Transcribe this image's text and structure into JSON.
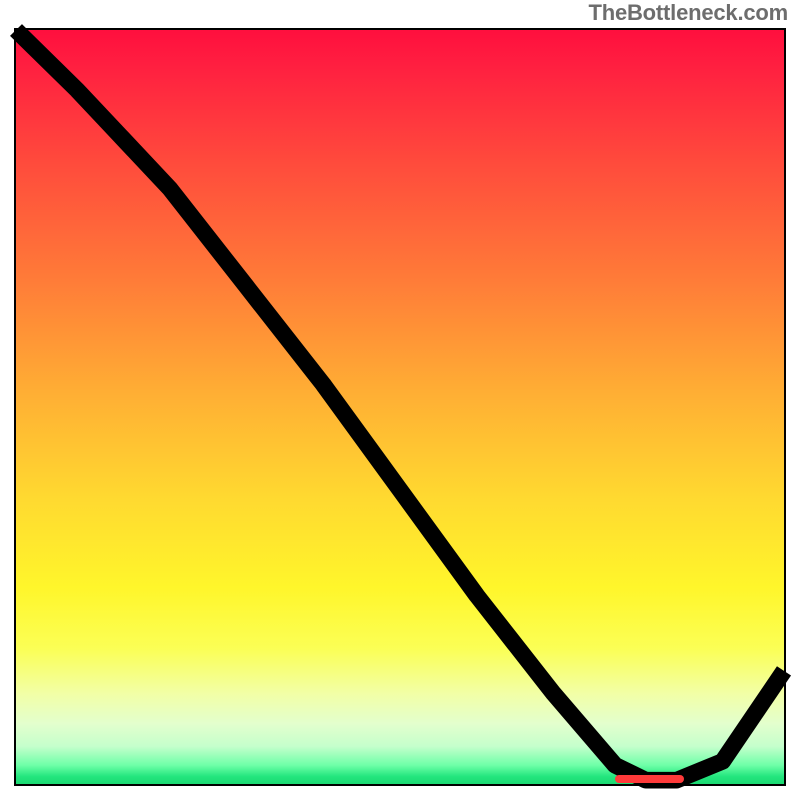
{
  "attribution": "TheBottleneck.com",
  "colors": {
    "gradient_top": "#ff0f3e",
    "gradient_mid": "#fff62b",
    "gradient_bottom": "#1bd972",
    "curve": "#000000",
    "marker": "#ff3a3a",
    "border": "#000000"
  },
  "chart_data": {
    "type": "line",
    "title": "",
    "xlabel": "",
    "ylabel": "",
    "xlim": [
      0,
      100
    ],
    "ylim": [
      0,
      100
    ],
    "grid": false,
    "legend": false,
    "annotations": [],
    "background": "red-yellow-green vertical gradient (bottleneck heat)",
    "series": [
      {
        "name": "bottleneck-curve",
        "x": [
          0,
          8,
          20,
          30,
          40,
          50,
          60,
          70,
          78,
          82,
          86,
          92,
          100
        ],
        "values": [
          100,
          92,
          79,
          66,
          53,
          39,
          25,
          12,
          2.5,
          0.5,
          0.5,
          3,
          15
        ]
      }
    ],
    "marker": {
      "x_start": 78,
      "x_end": 87,
      "y": 0.6,
      "meaning": "optimal / zero-bottleneck region"
    }
  }
}
